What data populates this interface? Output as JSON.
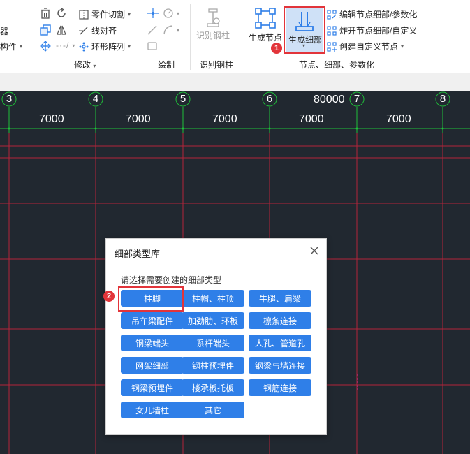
{
  "ribbon": {
    "left_cut": {
      "top": "器",
      "bottom": "构件"
    },
    "modify": {
      "label": "修改",
      "part_cut": "零件切割",
      "line_align": "线对齐",
      "ring_array": "环形阵列"
    },
    "draw": {
      "label": "绘制"
    },
    "recognize": {
      "label": "识别钢柱",
      "button": "识别钢柱"
    },
    "nodes": {
      "label": "节点、细部、参数化",
      "gen_node": "生成节点",
      "gen_detail": "生成细部",
      "edit_detail": "编辑节点细部/参数化",
      "explode_detail": "炸开节点细部/自定义",
      "create_custom_node": "创建自定义节点"
    }
  },
  "canvas": {
    "axis_numbers": [
      "3",
      "4",
      "5",
      "6",
      "7",
      "8"
    ],
    "spacings": [
      "7000",
      "7000",
      "7000",
      "7000",
      "7000"
    ],
    "total": "80000"
  },
  "dialog": {
    "title": "细部类型库",
    "subtitle": "请选择需要创建的细部类型",
    "buttons": [
      "柱脚",
      "柱帽、柱顶",
      "牛腿、肩梁",
      "吊车梁配件",
      "加劲肋、环板",
      "檩条连接",
      "钢梁端头",
      "系杆端头",
      "人孔、管道孔",
      "网架细部",
      "钢柱预埋件",
      "钢梁与墙连接",
      "钢梁预埋件",
      "楼承板托板",
      "钢筋连接",
      "女儿墙柱",
      "其它"
    ]
  },
  "badges": {
    "one": "1",
    "two": "2"
  },
  "colors": {
    "accent": "#2f7fe8",
    "highlight": "#e2343a",
    "canvas_bg": "#212830",
    "grid_red": "#b3243a",
    "grid_green": "#1fbf3a"
  }
}
